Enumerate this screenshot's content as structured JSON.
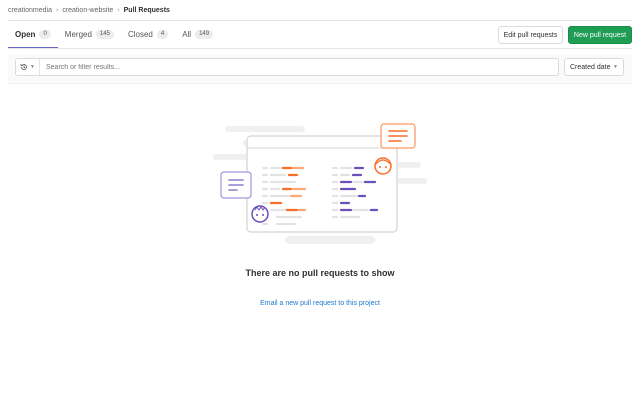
{
  "breadcrumb": {
    "group": "creationmedia",
    "project": "creation-website",
    "current": "Pull Requests"
  },
  "tabs": [
    {
      "label": "Open",
      "count": "0"
    },
    {
      "label": "Merged",
      "count": "145"
    },
    {
      "label": "Closed",
      "count": "4"
    },
    {
      "label": "All",
      "count": "149"
    }
  ],
  "actions": {
    "edit_label": "Edit pull requests",
    "new_label": "New pull request"
  },
  "filter": {
    "history_icon": "history-icon",
    "placeholder": "Search or filter results...",
    "sort_label": "Created date"
  },
  "empty_state": {
    "title": "There are no pull requests to show",
    "link": "Email a new pull request to this project"
  },
  "colors": {
    "accent_tab": "#6666c4",
    "primary_button": "#1f9d55",
    "link": "#1f78d1",
    "illustration_orange": "#fc6d26",
    "illustration_purple": "#6b4fbb"
  }
}
